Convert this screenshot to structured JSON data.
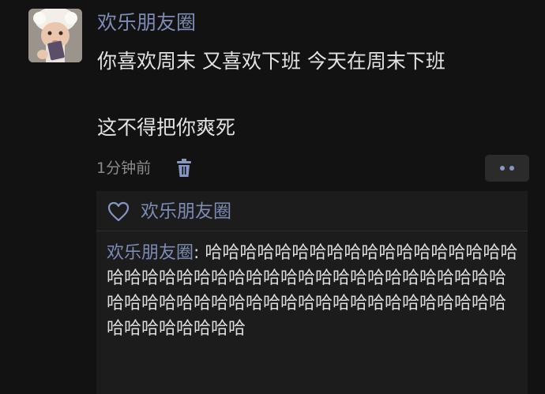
{
  "post": {
    "username": "欢乐朋友圈",
    "lines": [
      "你喜欢周末 又喜欢下班 今天在周末下班",
      "这不得把你爽死"
    ],
    "time": "1分钟前"
  },
  "actions": {
    "delete_icon": "trash-icon",
    "more_icon": "more-dots-icon"
  },
  "likes": {
    "icon": "heart-icon",
    "names": "欢乐朋友圈"
  },
  "comments": [
    {
      "author": "欢乐朋友圈",
      "separator": ": ",
      "text": "哈哈哈哈哈哈哈哈哈哈哈哈哈哈哈哈哈哈哈哈哈哈哈哈哈哈哈哈哈哈哈哈哈哈哈哈哈哈哈哈哈哈哈哈哈哈哈哈哈哈哈哈哈哈哈哈哈哈哈哈哈哈哈哈哈哈哈哈哈哈哈哈"
    }
  ],
  "colors": {
    "background": "#121212",
    "name_blue": "#7d8bb5",
    "comment_box": "#1c1c1c"
  }
}
